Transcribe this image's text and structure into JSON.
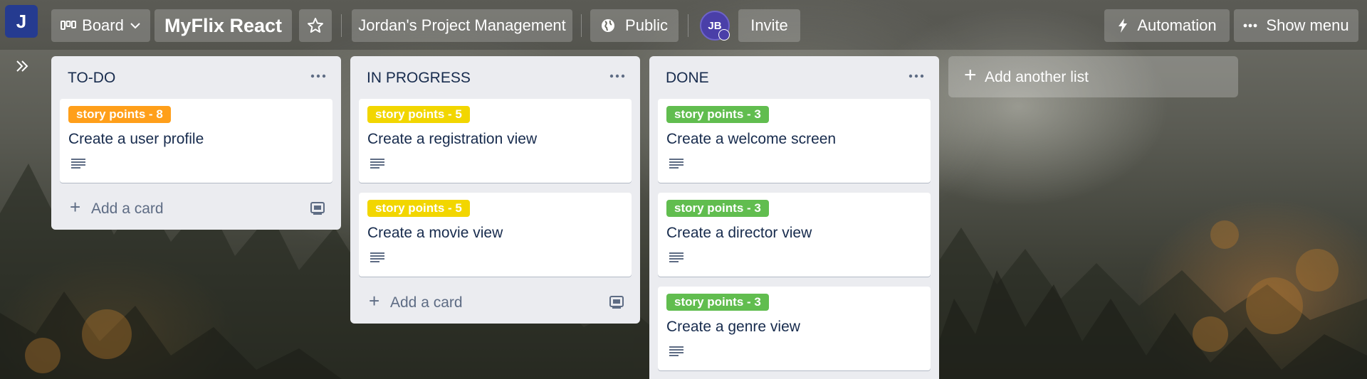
{
  "workspace_initial": "J",
  "header": {
    "view_label": "Board",
    "board_title": "MyFlix React",
    "workspace_name": "Jordan's Project Management",
    "visibility": "Public",
    "member_initials": "JB",
    "invite_label": "Invite",
    "automation_label": "Automation",
    "menu_label": "Show menu"
  },
  "lists": [
    {
      "title": "TO-DO",
      "cards": [
        {
          "label": "story points - 8",
          "label_color": "#ff9f1a",
          "title": "Create a user profile"
        }
      ],
      "add_card_label": "Add a card"
    },
    {
      "title": "IN PROGRESS",
      "cards": [
        {
          "label": "story points - 5",
          "label_color": "#f2d600",
          "title": "Create a registration view"
        },
        {
          "label": "story points - 5",
          "label_color": "#f2d600",
          "title": "Create a movie view"
        }
      ],
      "add_card_label": "Add a card"
    },
    {
      "title": "DONE",
      "cards": [
        {
          "label": "story points - 3",
          "label_color": "#61bd4f",
          "title": "Create a welcome screen"
        },
        {
          "label": "story points - 3",
          "label_color": "#61bd4f",
          "title": "Create a director view"
        },
        {
          "label": "story points - 3",
          "label_color": "#61bd4f",
          "title": "Create a genre view"
        }
      ]
    }
  ],
  "add_list_label": "Add another list",
  "colors": {
    "list_bg": "#ebecf0",
    "workspace_logo": "#253b90",
    "avatar": "#4a3fa8",
    "text_primary": "#172b4d"
  }
}
